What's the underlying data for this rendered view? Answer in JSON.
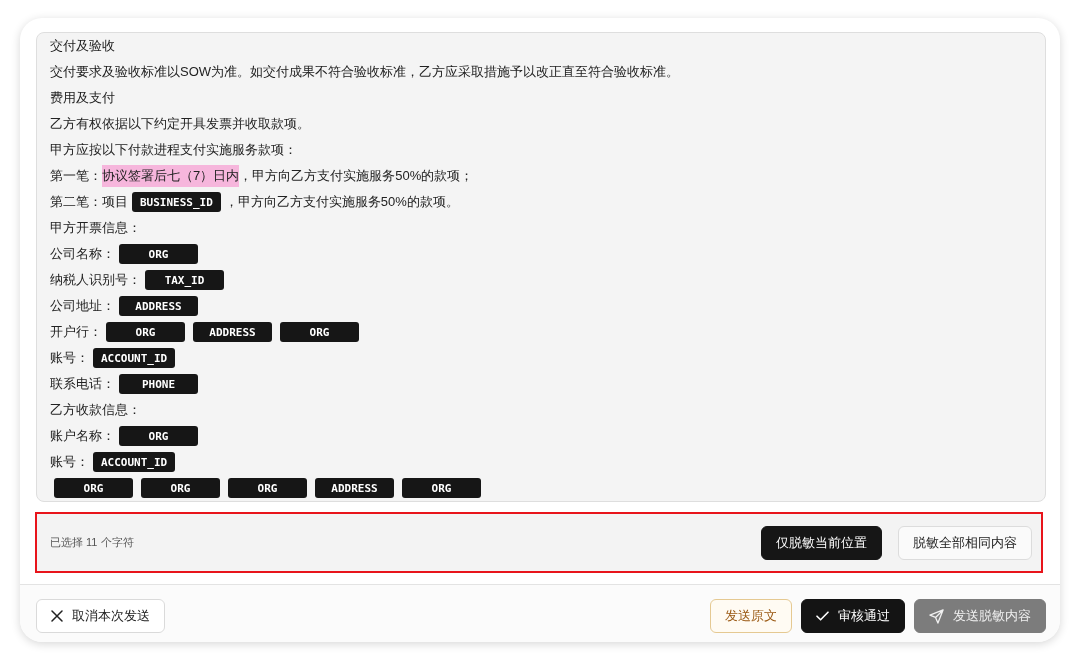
{
  "document": {
    "lines": [
      {
        "segments": [
          {
            "kind": "text",
            "text": "交付及验收"
          }
        ]
      },
      {
        "segments": [
          {
            "kind": "text",
            "text": "交付要求及验收标准以SOW为准。如交付成果不符合验收标准，乙方应采取措施予以改正直至符合验收标准。"
          }
        ]
      },
      {
        "segments": [
          {
            "kind": "text",
            "text": "费用及支付"
          }
        ]
      },
      {
        "segments": [
          {
            "kind": "text",
            "text": "乙方有权依据以下约定开具发票并收取款项。"
          }
        ]
      },
      {
        "segments": [
          {
            "kind": "text",
            "text": "甲方应按以下付款进程支付实施服务款项："
          }
        ]
      },
      {
        "segments": [
          {
            "kind": "text",
            "text": "第一笔："
          },
          {
            "kind": "highlight",
            "text": "协议签署后七（7）日内"
          },
          {
            "kind": "text",
            "text": "，甲方向乙方支付实施服务50%的款项；"
          }
        ]
      },
      {
        "segments": [
          {
            "kind": "text",
            "text": "第二笔：项目"
          },
          {
            "kind": "tag",
            "text": "BUSINESS_ID"
          },
          {
            "kind": "text",
            "text": "，甲方向乙方支付实施服务50%的款项。"
          }
        ]
      },
      {
        "segments": [
          {
            "kind": "text",
            "text": "甲方开票信息："
          }
        ]
      },
      {
        "segments": [
          {
            "kind": "text",
            "text": "公司名称："
          },
          {
            "kind": "tag",
            "text": "ORG"
          }
        ]
      },
      {
        "segments": [
          {
            "kind": "text",
            "text": "纳税人识别号："
          },
          {
            "kind": "tag",
            "text": "TAX_ID"
          }
        ]
      },
      {
        "segments": [
          {
            "kind": "text",
            "text": "公司地址："
          },
          {
            "kind": "tag",
            "text": "ADDRESS"
          }
        ]
      },
      {
        "segments": [
          {
            "kind": "text",
            "text": "开户行："
          },
          {
            "kind": "tag",
            "text": "ORG"
          },
          {
            "kind": "tag",
            "text": "ADDRESS"
          },
          {
            "kind": "tag",
            "text": "ORG"
          }
        ]
      },
      {
        "segments": [
          {
            "kind": "text",
            "text": "账号："
          },
          {
            "kind": "tag",
            "text": "ACCOUNT_ID"
          }
        ]
      },
      {
        "segments": [
          {
            "kind": "text",
            "text": "联系电话："
          },
          {
            "kind": "tag",
            "text": "PHONE"
          }
        ]
      },
      {
        "segments": [
          {
            "kind": "text",
            "text": "乙方收款信息："
          }
        ]
      },
      {
        "segments": [
          {
            "kind": "text",
            "text": "账户名称："
          },
          {
            "kind": "tag",
            "text": "ORG"
          }
        ]
      },
      {
        "segments": [
          {
            "kind": "text",
            "text": "账号："
          },
          {
            "kind": "tag",
            "text": "ACCOUNT_ID"
          }
        ]
      },
      {
        "segments": [
          {
            "kind": "tag",
            "text": "ORG"
          },
          {
            "kind": "tag",
            "text": "ORG"
          },
          {
            "kind": "tag",
            "text": "ORG"
          },
          {
            "kind": "tag",
            "text": "ADDRESS"
          },
          {
            "kind": "tag",
            "text": "ORG"
          }
        ]
      }
    ]
  },
  "selection_bar": {
    "status": "已选择 11 个字符",
    "buttons": [
      {
        "label": "仅脱敏当前位置",
        "kind": "primary"
      },
      {
        "label": "脱敏全部相同内容",
        "kind": "secondary"
      }
    ]
  },
  "footer": {
    "left_buttons": [
      {
        "label": "取消本次发送",
        "kind": "cancel",
        "disabled": false
      }
    ],
    "right_buttons": [
      {
        "label": "发送原文",
        "kind": "original",
        "disabled": false
      },
      {
        "label": "审核通过",
        "kind": "approve",
        "disabled": false
      },
      {
        "label": "发送脱敏内容",
        "kind": "send",
        "disabled": true
      }
    ]
  }
}
